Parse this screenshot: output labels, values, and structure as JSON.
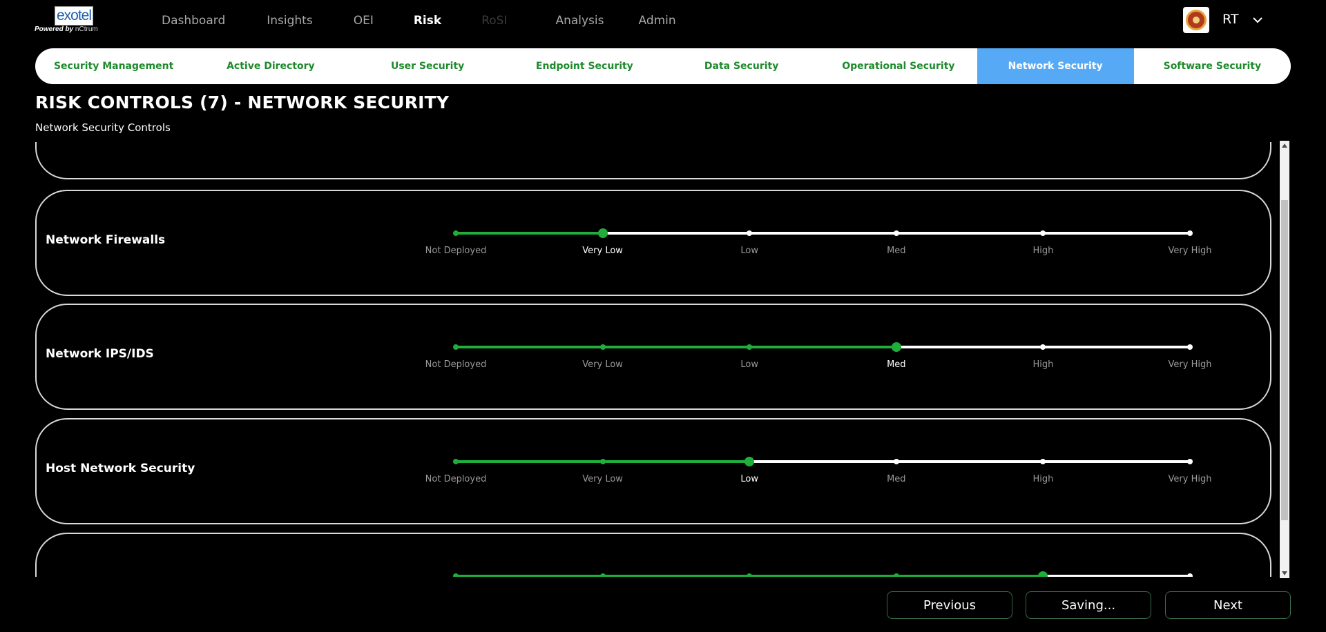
{
  "logo": {
    "word": "exotel",
    "tagline": "Powered by",
    "brand": "nCtrum"
  },
  "nav": {
    "items": [
      {
        "label": "Dashboard",
        "state": "normal"
      },
      {
        "label": "Insights",
        "state": "normal"
      },
      {
        "label": "OEI",
        "state": "normal"
      },
      {
        "label": "Risk",
        "state": "active"
      },
      {
        "label": "RoSI",
        "state": "disabled"
      },
      {
        "label": "Analysis",
        "state": "normal"
      },
      {
        "label": "Admin",
        "state": "normal"
      }
    ]
  },
  "user": {
    "initials": "RT",
    "avatar_icon": "company-seal-icon",
    "menu_icon": "chevron-down-icon"
  },
  "tabs": [
    {
      "label": "Security Management",
      "active": false
    },
    {
      "label": "Active Directory",
      "active": false
    },
    {
      "label": "User Security",
      "active": false
    },
    {
      "label": "Endpoint Security",
      "active": false
    },
    {
      "label": "Data Security",
      "active": false
    },
    {
      "label": "Operational Security",
      "active": false
    },
    {
      "label": "Network Security",
      "active": true
    },
    {
      "label": "Software Security",
      "active": false
    }
  ],
  "page": {
    "title": "RISK CONTROLS (7) - NETWORK SECURITY",
    "subtitle": "Network Security Controls"
  },
  "levels": [
    "Not Deployed",
    "Very Low",
    "Low",
    "Med",
    "High",
    "Very High"
  ],
  "controls": [
    {
      "name": "",
      "level_index": null,
      "partial": "top"
    },
    {
      "name": "Network Firewalls",
      "level_index": 1
    },
    {
      "name": "Network IPS/IDS",
      "level_index": 3
    },
    {
      "name": "Host Network Security",
      "level_index": 2
    },
    {
      "name": "",
      "level_index": 4,
      "partial": "bottom"
    }
  ],
  "buttons": {
    "previous": "Previous",
    "save": "Saving...",
    "next": "Next"
  },
  "colors": {
    "accent_green": "#1fae3a",
    "tab_green": "#1d8a2c",
    "active_tab_blue": "#56aaf5"
  }
}
